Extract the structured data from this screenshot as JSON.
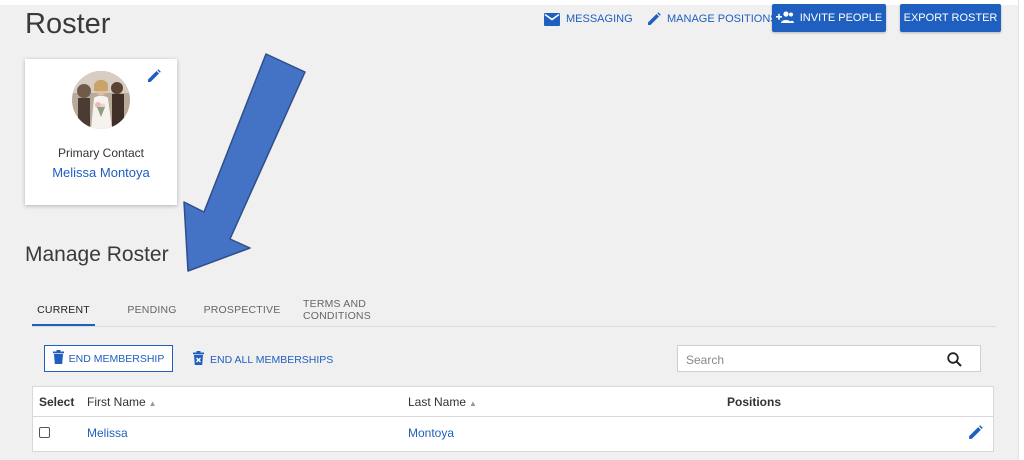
{
  "header": {
    "title": "Roster",
    "actions": {
      "messaging": "MESSAGING",
      "manage_positions": "MANAGE POSITIONS",
      "invite_people": "INVITE PEOPLE",
      "export_roster": "EXPORT ROSTER"
    }
  },
  "primary_contact": {
    "label": "Primary Contact",
    "name": "Melissa Montoya"
  },
  "manage_roster": {
    "title": "Manage Roster",
    "tabs": [
      {
        "label": "CURRENT",
        "active": true
      },
      {
        "label": "PENDING",
        "active": false
      },
      {
        "label": "PROSPECTIVE",
        "active": false
      },
      {
        "label": "TERMS AND CONDITIONS",
        "active": false
      }
    ],
    "end_membership": "END MEMBERSHIP",
    "end_all_memberships": "END ALL MEMBERSHIPS",
    "search": {
      "placeholder": "Search",
      "value": ""
    }
  },
  "table": {
    "columns": {
      "select": "Select",
      "first_name": "First Name",
      "last_name": "Last Name",
      "positions": "Positions"
    },
    "rows": [
      {
        "first_name": "Melissa",
        "last_name": "Montoya",
        "positions": "",
        "selected": false
      }
    ]
  },
  "colors": {
    "accent": "#1f5fbf",
    "annotation_arrow": "#4472c4",
    "page_background": "#f0f0f0"
  }
}
